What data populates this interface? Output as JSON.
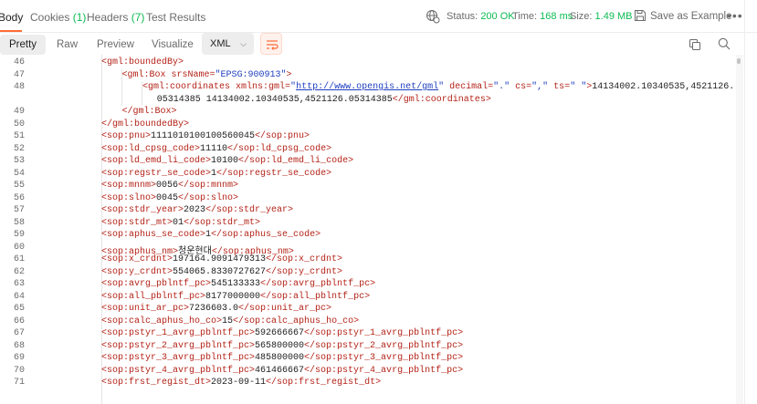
{
  "response_tabs": [
    {
      "label": "Body",
      "count": "",
      "active": true
    },
    {
      "label": "Cookies",
      "count": "(1)",
      "active": false
    },
    {
      "label": "Headers",
      "count": "(7)",
      "active": false
    },
    {
      "label": "Test Results",
      "count": "",
      "active": false
    }
  ],
  "status": {
    "status_label": "Status:",
    "status_value": "200 OK",
    "time_label": "Time:",
    "time_value": "168 ms",
    "size_label": "Size:",
    "size_value": "1.49 MB"
  },
  "save_example_label": "Save as Example",
  "more_icon": "more-horizontal-icon",
  "view_modes": [
    "Pretty",
    "Raw",
    "Preview",
    "Visualize"
  ],
  "active_view": "Pretty",
  "format": "XML",
  "colors": {
    "accent": "#ff6c37",
    "success": "#0cbb52",
    "tag": "#b42318",
    "attr_value": "#1f3fbf"
  },
  "code_lines": [
    {
      "n": "46",
      "indent": 2,
      "parts": [
        [
          "tag",
          "<gml:boundedBy>"
        ]
      ]
    },
    {
      "n": "47",
      "indent": 3,
      "parts": [
        [
          "tag",
          "<gml:Box "
        ],
        [
          "attr",
          "srsName="
        ],
        [
          "aval",
          "\"EPSG:900913\""
        ],
        [
          "tag",
          ">"
        ]
      ]
    },
    {
      "n": "48",
      "indent": 4,
      "parts": [
        [
          "tag",
          "<gml:coordinates "
        ],
        [
          "attr",
          "xmlns:gml="
        ],
        [
          "aval",
          "\""
        ],
        [
          "link",
          "http://www.opengis.net/gml"
        ],
        [
          "aval",
          "\""
        ],
        [
          "attr",
          " decimal="
        ],
        [
          "aval",
          "\".\""
        ],
        [
          "attr",
          " cs="
        ],
        [
          "aval",
          "\",\""
        ],
        [
          "attr",
          " ts="
        ],
        [
          "aval",
          "\" \""
        ],
        [
          "tag",
          ">"
        ],
        [
          "plain",
          "14134002.10340535,4521126."
        ]
      ]
    },
    {
      "n": "",
      "indent": 4.7,
      "parts": [
        [
          "plain",
          "05314385 14134002.10340535,4521126.05314385"
        ],
        [
          "tag",
          "</gml:coordinates>"
        ]
      ]
    },
    {
      "n": "49",
      "indent": 3,
      "parts": [
        [
          "tag",
          "</gml:Box>"
        ]
      ]
    },
    {
      "n": "50",
      "indent": 2,
      "parts": [
        [
          "tag",
          "</gml:boundedBy>"
        ]
      ]
    },
    {
      "n": "51",
      "indent": 2,
      "parts": [
        [
          "tag",
          "<sop:pnu>"
        ],
        [
          "plain",
          "1111010100100560045"
        ],
        [
          "tag",
          "</sop:pnu>"
        ]
      ]
    },
    {
      "n": "52",
      "indent": 2,
      "parts": [
        [
          "tag",
          "<sop:ld_cpsg_code>"
        ],
        [
          "plain",
          "11110"
        ],
        [
          "tag",
          "</sop:ld_cpsg_code>"
        ]
      ]
    },
    {
      "n": "53",
      "indent": 2,
      "parts": [
        [
          "tag",
          "<sop:ld_emd_li_code>"
        ],
        [
          "plain",
          "10100"
        ],
        [
          "tag",
          "</sop:ld_emd_li_code>"
        ]
      ]
    },
    {
      "n": "54",
      "indent": 2,
      "parts": [
        [
          "tag",
          "<sop:regstr_se_code>"
        ],
        [
          "plain",
          "1"
        ],
        [
          "tag",
          "</sop:regstr_se_code>"
        ]
      ]
    },
    {
      "n": "55",
      "indent": 2,
      "parts": [
        [
          "tag",
          "<sop:mnnm>"
        ],
        [
          "plain",
          "0056"
        ],
        [
          "tag",
          "</sop:mnnm>"
        ]
      ]
    },
    {
      "n": "56",
      "indent": 2,
      "parts": [
        [
          "tag",
          "<sop:slno>"
        ],
        [
          "plain",
          "0045"
        ],
        [
          "tag",
          "</sop:slno>"
        ]
      ]
    },
    {
      "n": "57",
      "indent": 2,
      "parts": [
        [
          "tag",
          "<sop:stdr_year>"
        ],
        [
          "plain",
          "2023"
        ],
        [
          "tag",
          "</sop:stdr_year>"
        ]
      ]
    },
    {
      "n": "58",
      "indent": 2,
      "parts": [
        [
          "tag",
          "<sop:stdr_mt>"
        ],
        [
          "plain",
          "01"
        ],
        [
          "tag",
          "</sop:stdr_mt>"
        ]
      ]
    },
    {
      "n": "59",
      "indent": 2,
      "parts": [
        [
          "tag",
          "<sop:aphus_se_code>"
        ],
        [
          "plain",
          "1"
        ],
        [
          "tag",
          "</sop:aphus_se_code>"
        ]
      ]
    },
    {
      "n": "60",
      "indent": 2,
      "parts": [
        [
          "tag",
          "<sop:aphus_nm>"
        ],
        [
          "plain",
          "청운현대"
        ],
        [
          "tag",
          "</sop:aphus_nm>"
        ]
      ]
    },
    {
      "n": "61",
      "indent": 2,
      "parts": [
        [
          "tag",
          "<sop:x_crdnt>"
        ],
        [
          "plain",
          "197164.9091479313"
        ],
        [
          "tag",
          "</sop:x_crdnt>"
        ]
      ]
    },
    {
      "n": "62",
      "indent": 2,
      "parts": [
        [
          "tag",
          "<sop:y_crdnt>"
        ],
        [
          "plain",
          "554065.8330727627"
        ],
        [
          "tag",
          "</sop:y_crdnt>"
        ]
      ]
    },
    {
      "n": "63",
      "indent": 2,
      "parts": [
        [
          "tag",
          "<sop:avrg_pblntf_pc>"
        ],
        [
          "plain",
          "545133333"
        ],
        [
          "tag",
          "</sop:avrg_pblntf_pc>"
        ]
      ]
    },
    {
      "n": "64",
      "indent": 2,
      "parts": [
        [
          "tag",
          "<sop:all_pblntf_pc>"
        ],
        [
          "plain",
          "8177000000"
        ],
        [
          "tag",
          "</sop:all_pblntf_pc>"
        ]
      ]
    },
    {
      "n": "65",
      "indent": 2,
      "parts": [
        [
          "tag",
          "<sop:unit_ar_pc>"
        ],
        [
          "plain",
          "7236603.0"
        ],
        [
          "tag",
          "</sop:unit_ar_pc>"
        ]
      ]
    },
    {
      "n": "66",
      "indent": 2,
      "parts": [
        [
          "tag",
          "<sop:calc_aphus_ho_co>"
        ],
        [
          "plain",
          "15"
        ],
        [
          "tag",
          "</sop:calc_aphus_ho_co>"
        ]
      ]
    },
    {
      "n": "67",
      "indent": 2,
      "parts": [
        [
          "tag",
          "<sop:pstyr_1_avrg_pblntf_pc>"
        ],
        [
          "plain",
          "592666667"
        ],
        [
          "tag",
          "</sop:pstyr_1_avrg_pblntf_pc>"
        ]
      ]
    },
    {
      "n": "68",
      "indent": 2,
      "parts": [
        [
          "tag",
          "<sop:pstyr_2_avrg_pblntf_pc>"
        ],
        [
          "plain",
          "565800000"
        ],
        [
          "tag",
          "</sop:pstyr_2_avrg_pblntf_pc>"
        ]
      ]
    },
    {
      "n": "69",
      "indent": 2,
      "parts": [
        [
          "tag",
          "<sop:pstyr_3_avrg_pblntf_pc>"
        ],
        [
          "plain",
          "485800000"
        ],
        [
          "tag",
          "</sop:pstyr_3_avrg_pblntf_pc>"
        ]
      ]
    },
    {
      "n": "70",
      "indent": 2,
      "parts": [
        [
          "tag",
          "<sop:pstyr_4_avrg_pblntf_pc>"
        ],
        [
          "plain",
          "461466667"
        ],
        [
          "tag",
          "</sop:pstyr_4_avrg_pblntf_pc>"
        ]
      ]
    },
    {
      "n": "71",
      "indent": 2,
      "parts": [
        [
          "tag",
          "<sop:frst_regist_dt>"
        ],
        [
          "plain",
          "2023-09-11"
        ],
        [
          "tag",
          "</sop:frst_regist_dt>"
        ]
      ]
    }
  ]
}
